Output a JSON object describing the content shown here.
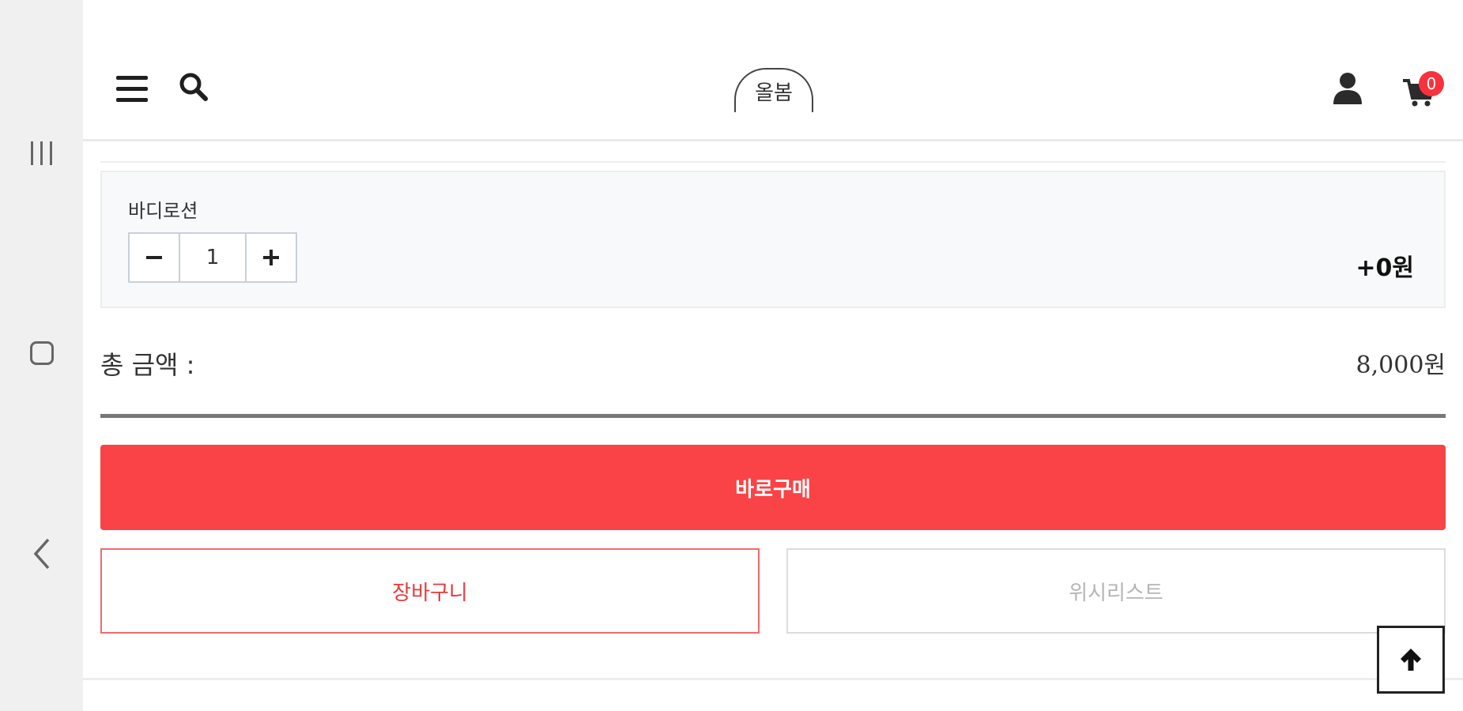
{
  "header": {
    "logo_text": "올봄",
    "cart_count": "0"
  },
  "option": {
    "name": "바디로션",
    "quantity": "1",
    "price_delta": "+0원"
  },
  "total": {
    "label": "총 금액 :",
    "value": "8,000원"
  },
  "actions": {
    "buy_label": "바로구매",
    "cart_label": "장바구니",
    "wishlist_label": "위시리스트"
  },
  "colors": {
    "accent": "#f94346",
    "cart_border": "#f06a6c",
    "badge": "#f8323c"
  },
  "icons": [
    "menu-icon",
    "search-icon",
    "user-icon",
    "cart-icon",
    "minus-icon",
    "plus-icon",
    "arrow-up-icon",
    "recents-icon",
    "home-icon",
    "back-icon"
  ]
}
